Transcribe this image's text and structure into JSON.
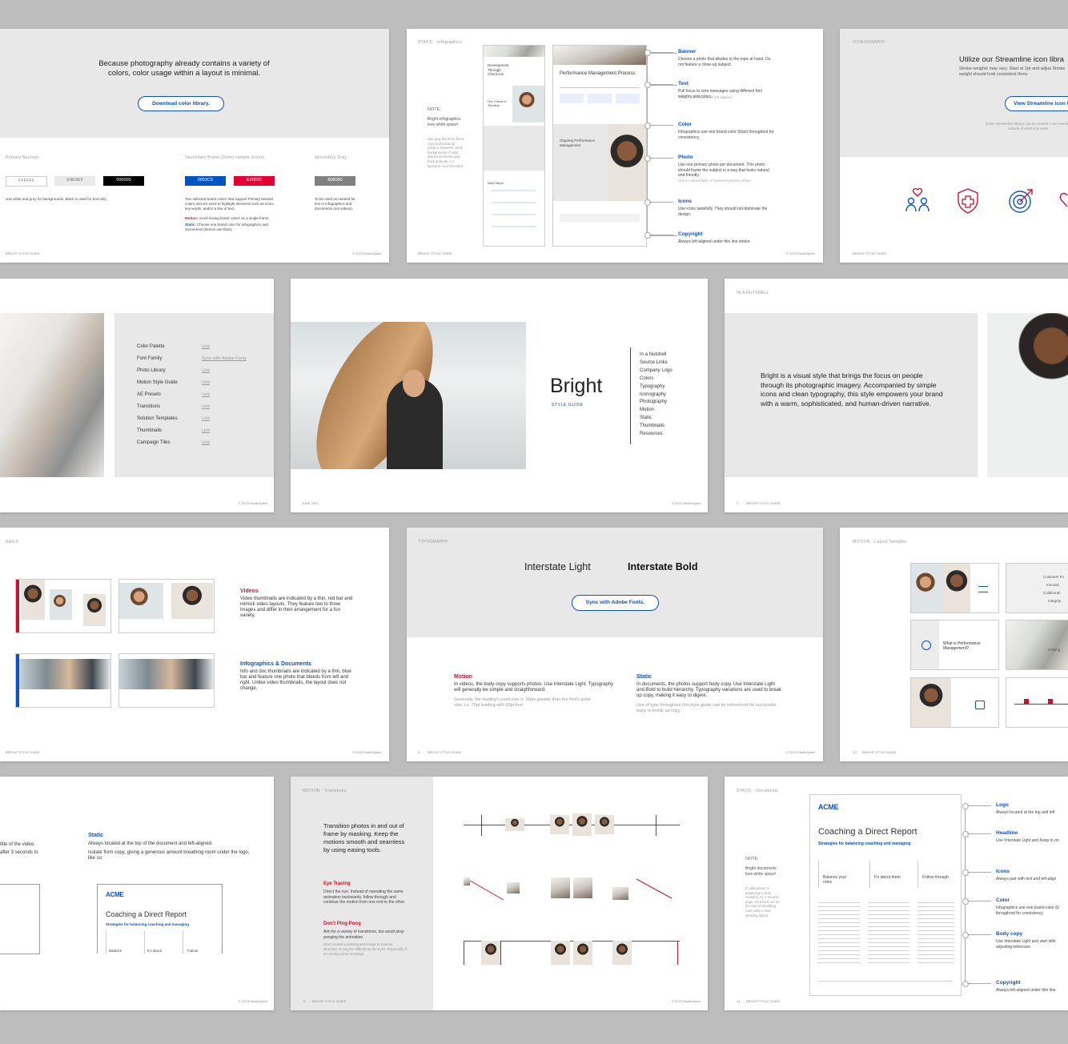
{
  "row1": {
    "color_slide": {
      "intro": "Because photography already contains a variety of colors, color usage within a layout is minimal.",
      "button": "Download color library.",
      "primary_neutrals_label": "Primary Neutrals",
      "secondary_brand_label": "Secondary Brand (Demo sample colors)",
      "secondary_gray_label": "Secondary Gray",
      "swatches_neutral": [
        "FFFFFF",
        "E9E9E9",
        "000000"
      ],
      "swatches_brand": [
        "0053C5",
        "E30032"
      ],
      "swatch_gray": "808080",
      "neutral_note": "Use white and grey for backgrounds. Black is used for text only.",
      "brand_note": "Two selected brand colors that support Primary Neutral colors and are used to highlight elements such as icons, key words, and/or a line of text.",
      "motion_note_label": "Motion:",
      "motion_note": "Avoid mixing brand colors on a single frame.",
      "static_note_label": "Static:",
      "static_note": "Choose one brand color for infographics and documents (demos use blue).",
      "gray_note": "To be used as needed for text in infographics and documents (not videos).",
      "footer_left": "BRIGHT STYLE GUIDE",
      "footer_right": "© 2023 StudioSpark"
    },
    "infographics_slide": {
      "section": "STATIC",
      "subsection": "Infographics",
      "note_label": "NOTE:",
      "note_title": "Bright infographics love white space!",
      "note_body": "Use gray blocks to focus copy and break up content. However, all its backgrounds of solid always dominate gray back grounds. A 2 typical is recommended.",
      "doc1_title": "Development Through Check-ins",
      "doc1_sub": "Our Check-in Timeline",
      "doc1_next": "Next Steps",
      "doc2_title": "Performance Management Process",
      "doc2_sub": "Ongoing Performance Management",
      "callouts": [
        {
          "title": "Banner",
          "body": "Choose a photo that alludes to the topic at hand. Do not feature a close-up subject."
        },
        {
          "title": "Text",
          "body": "Pull focus to core messages using different font weights and colors.",
          "extra": "Text should always be left aligned."
        },
        {
          "title": "Color",
          "body": "Infographics use one brand color (blue) throughout for consistency."
        },
        {
          "title": "Photo",
          "body": "Use one primary photo per document. This photo should frame the subject in a way that looks natural and friendly.",
          "extra": "Use in natural light, or between primary photo."
        },
        {
          "title": "Icons",
          "body": "Use icons tastefully. They should not dominate the design."
        },
        {
          "title": "Copyright",
          "body": "Always left-aligned under thin line stroke."
        }
      ],
      "footer_left": "BRIGHT STYLE GUIDE",
      "footer_right": "© 2023 StudioSpark"
    },
    "iconography_slide": {
      "section": "ICONOGRAPHY",
      "title": "Utilize our Streamline icon libra",
      "body": "Stroke weights may vary. Start at 2pt and adjus Stroke weight should look consistent throu",
      "button": "View Streamline icon l",
      "note": "Entire Streamline library can be viewed o are needed outside of what is provide",
      "icons": [
        "people-heart-icon",
        "shield-cross-icon",
        "target-arrow-icon",
        "heart-icon"
      ],
      "footer_left": "BRIGHT STYLE GUIDE"
    }
  },
  "row2": {
    "resources_slide": {
      "items": [
        {
          "label": "Color Palette",
          "link": "Link"
        },
        {
          "label": "Font Family",
          "link": "Sync with Adobe Fonts"
        },
        {
          "label": "Photo Library",
          "link": "Link"
        },
        {
          "label": "Motion Style Guide",
          "link": "Link"
        },
        {
          "label": "AE Presets",
          "link": "Link"
        },
        {
          "label": "Transitions",
          "link": "Link"
        },
        {
          "label": "Solution Templates",
          "link": "Link"
        },
        {
          "label": "Thumbnails",
          "link": "Link"
        },
        {
          "label": "Campaign Tiles",
          "link": "Link"
        }
      ],
      "footer_right": "© 2023 StudioSpark"
    },
    "cover_slide": {
      "title": "Bright",
      "subtitle": "STYLE GUIDE",
      "toc": [
        "In a Nutshell",
        "Source Links",
        "Company Logo",
        "Colors",
        "Typography",
        "Iconography",
        "Photography",
        "Motion",
        "Static",
        "Thumbnails",
        "Resources"
      ],
      "footer_left": "JUNE 2023",
      "footer_right": "© 2023 StudioSpark"
    },
    "nutshell_slide": {
      "section": "IN A NUTSHELL",
      "body": "Bright is a visual style that brings the focus on people through its photographic imagery. Accompanied by simple icons and clean typography, this style empowers your brand with a warm, sophisticated, and human-driven narrative.",
      "page": "2",
      "footer_left": "BRIGHT STYLE GUIDE"
    }
  },
  "row3": {
    "thumbnails_slide": {
      "section": "NAILS",
      "videos_title": "Videos",
      "videos_body": "Video thumbnails are indicated by a thin, red bar and mimick video layouts. They feature two to three images and differ in their arrangement for a fun variety.",
      "infographics_title": "Infographics & Documents",
      "infographics_body": "Info and doc thumbnails are indicated by a thin, blue bar and feature one photo that bleeds from left and right. Unlike video thumbnails, the layout does not change.",
      "footer_left": "BRIGHT STYLE GUIDE",
      "footer_right": "© 2023 StudioSpark"
    },
    "typography_slide": {
      "section": "TYPOGRAPHY",
      "font_light": "Interstate Light",
      "font_bold": "Interstate Bold",
      "button": "Sync with Adobe Fonts.",
      "motion_title": "Motion",
      "motion_body": "In videos, the body copy supports photos. Use Interstate Light. Typography will generally be simple and straighforward.",
      "motion_extra": "Generally, the leading's point size is 10pts greater than the font's point size, i.e. 70pt leading with 60pt font",
      "static_title": "Static",
      "static_body": "In documents, the photos support body copy. Use Interstate Light and Bold to build hierarchy. Typography variations are used to break up copy, making it easy to digest.",
      "static_extra": "Use of type throughout this style guide can be referenced for successful ways to break up copy.",
      "page": "6",
      "footer_left": "BRIGHT STYLE GUIDE",
      "footer_right": "© 2023 StudioSpark"
    },
    "motion_layout_slide": {
      "section": "MOTION",
      "subsection": "Layout Samples",
      "question": "What is Performance Management?",
      "side_text_1": "Customer Fo",
      "side_text_2": "Innovati",
      "side_text_3": "Collaborati",
      "side_text_4": "Integrity",
      "side_text_5": "Helping",
      "page": "10",
      "footer_left": "BRIGHT STYLE GUIDE"
    }
  },
  "row4": {
    "static_slide": {
      "left_text_1": "title of the video.",
      "left_text_2": "after 3 seconds to",
      "static_title": "Static",
      "static_body_1": "Always located at the top of the document and left-aligned.",
      "static_body_2": "Isolate from copy, giving a generous amount breathing room under the logo, like so:",
      "logo": "ACME",
      "doc_title": "Coaching a Direct Report",
      "doc_sub": "Strategies for balancing coaching and managing",
      "icons": [
        "Balance",
        "It's about",
        "Follow"
      ],
      "footer_right": "© 2023 StudioSpark"
    },
    "transitions_slide": {
      "section": "MOTION",
      "subsection": "Transitions",
      "intro": "Transition photos in and out of frame by masking. Keep the motions smooth and seamless by using easing tools.",
      "eye_title": "Eye Tracing",
      "eye_body": "Direct the eye. Instead of repeating the same animation backwards, follow through and continue the motion from one end to the other.",
      "ping_title": "Don't Ping-Pong",
      "ping_body": "Aim for a variety of transitions, but avoid ping-ponging the animation.",
      "ping_extra": "Don't reveal a subsequent image in reverse direction. It may be difficult as the eyes. Especially if it's a long photo montage.",
      "page": "11",
      "footer_left": "BRIGHT STYLE GUIDE",
      "footer_right": "© 2023 StudioSpark"
    },
    "documents_slide": {
      "section": "STATIC",
      "subsection": "Documents",
      "note_label": "NOTE:",
      "note_title": "Bright documents love white space!",
      "note_body": "If a document is beginning to look crowded, try a second page. It's best to err on the side of breathing room with a clear pleasing layout.",
      "logo": "ACME",
      "doc_title": "Coaching a Direct Report",
      "doc_sub": "Strategies for balancing coaching and managing",
      "doc_icons": [
        "Balance your roles",
        "It's about them",
        "Follow through"
      ],
      "callouts": [
        {
          "title": "Logo",
          "body": "Always located at the top and left"
        },
        {
          "title": "Headline",
          "body": "Use Interstate Light and Keep to on"
        },
        {
          "title": "Icons",
          "body": "Always pair with text and left-align"
        },
        {
          "title": "Color",
          "body": "Infographics use one brand color (b throughout for consistency."
        },
        {
          "title": "Body copy",
          "body": "Use Interstate Light and start with adjusting lettercase."
        },
        {
          "title": "Copyright",
          "body": "Always left-aligned under thin line"
        }
      ],
      "page": "14",
      "footer_left": "BRIGHT STYLE GUIDE"
    }
  },
  "colors": {
    "brand_blue": "#0b4fc9",
    "brand_red": "#d0102e",
    "gray": "#808080",
    "light_gray": "#e9e9e9",
    "background": "#bdbdbd"
  }
}
